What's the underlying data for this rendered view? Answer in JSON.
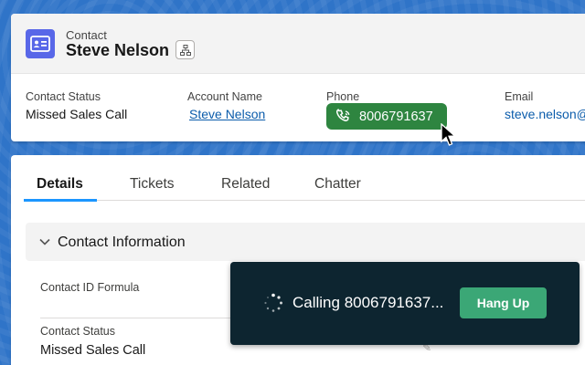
{
  "header": {
    "object_type": "Contact",
    "record_name": "Steve Nelson",
    "fields": [
      {
        "label": "Contact Status",
        "value": "Missed Sales Call"
      },
      {
        "label": "Account Name",
        "value": "Steve Nelson"
      },
      {
        "label": "Phone",
        "value": "8006791637"
      },
      {
        "label": "Email",
        "value": "steve.nelson@"
      }
    ]
  },
  "tabs": [
    "Details",
    "Tickets",
    "Related",
    "Chatter"
  ],
  "active_tab": "Details",
  "section": {
    "title": "Contact Information"
  },
  "detail_fields": [
    {
      "label": "Contact ID Formula",
      "value": ""
    },
    {
      "label": "Contact Status",
      "value": "Missed Sales Call"
    }
  ],
  "call_toast": {
    "status_text": "Calling 8006791637...",
    "hangup_label": "Hang Up"
  },
  "colors": {
    "background": "#2f74c8",
    "contact_icon": "#5867e8",
    "phone_pill": "#2e8540",
    "toast_bg": "#0d2530",
    "hangup": "#3ba776",
    "tab_active": "#1b96ff"
  },
  "icons": [
    "contact-card-icon",
    "hierarchy-icon",
    "phone-icon",
    "mouse-pointer-icon",
    "chevron-down-icon",
    "pencil-icon",
    "loading-spinner-icon"
  ]
}
